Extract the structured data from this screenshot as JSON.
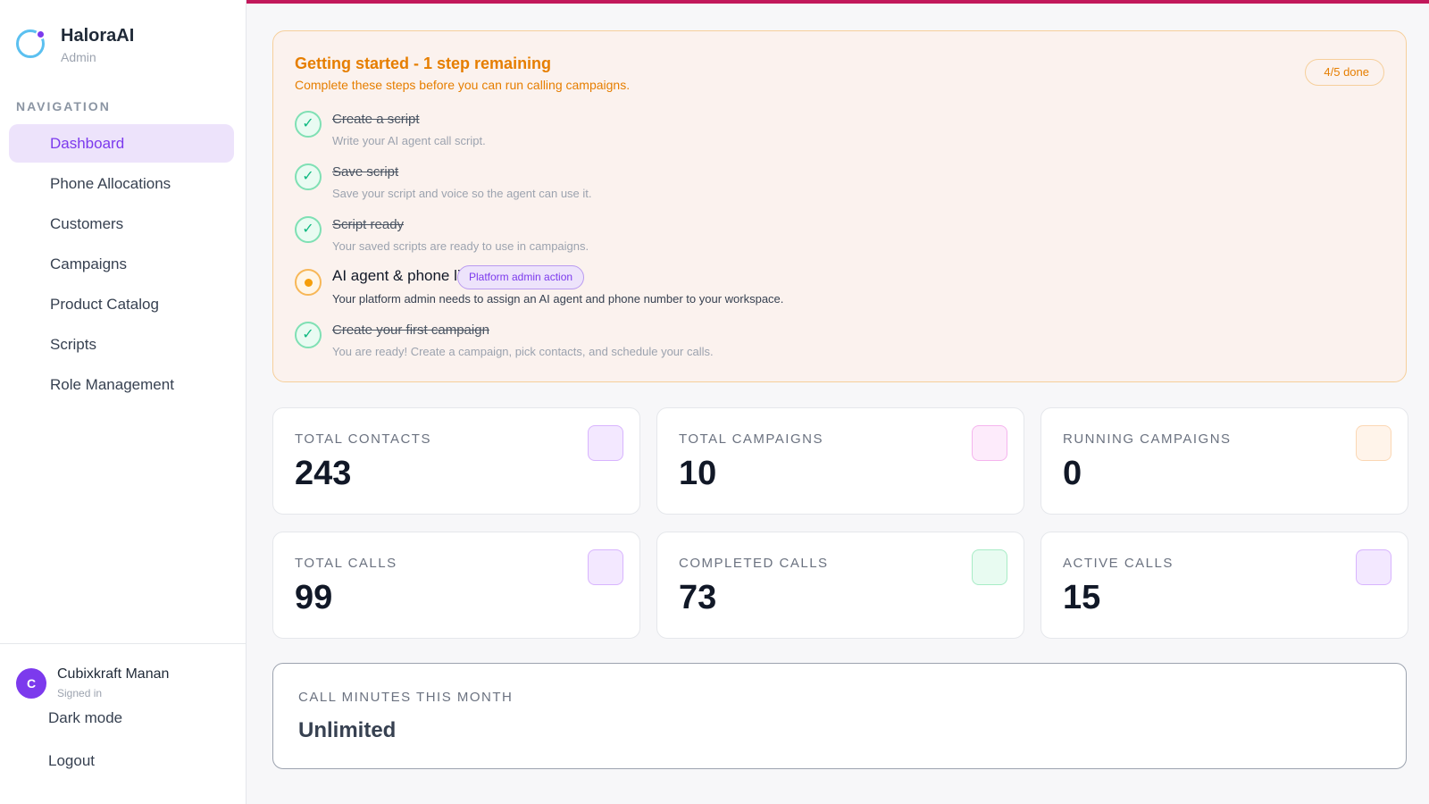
{
  "brand": {
    "name": "HaloraAI",
    "role": "Admin"
  },
  "nav": {
    "heading": "NAVIGATION",
    "items": [
      {
        "label": "Dashboard",
        "active": true
      },
      {
        "label": "Phone Allocations"
      },
      {
        "label": "Customers"
      },
      {
        "label": "Campaigns"
      },
      {
        "label": "Product Catalog"
      },
      {
        "label": "Scripts"
      },
      {
        "label": "Role Management"
      }
    ]
  },
  "user": {
    "initial": "C",
    "name": "Cubixkraft Manan",
    "status": "Signed in"
  },
  "footer": {
    "dark_mode": "Dark mode",
    "logout": "Logout"
  },
  "getting_started": {
    "title": "Getting started - 1 step remaining",
    "subtitle": "Complete these steps before you can run calling campaigns.",
    "progress": "4/5 done",
    "steps": [
      {
        "title": "Create a script",
        "description": "Write your AI agent call script.",
        "done": true
      },
      {
        "title": "Save script",
        "description": "Save your script and voice so the agent can use it.",
        "done": true
      },
      {
        "title": "Script ready",
        "description": "Your saved scripts are ready to use in campaigns.",
        "done": true
      },
      {
        "title": "AI agent & phone linked",
        "badge": "Platform admin action",
        "description": "Your platform admin needs to assign an AI agent and phone number to your workspace.",
        "done": false
      },
      {
        "title": "Create your first campaign",
        "description": "You are ready! Create a campaign, pick contacts, and schedule your calls.",
        "done": true
      }
    ],
    "check_glyph": "✓"
  },
  "stats": [
    {
      "label": "TOTAL CONTACTS",
      "value": "243",
      "icon_bg": "#f3e8ff",
      "icon_border": "#d8b4fe"
    },
    {
      "label": "TOTAL CAMPAIGNS",
      "value": "10",
      "icon_bg": "#fdebfb",
      "icon_border": "#f5b4ee"
    },
    {
      "label": "RUNNING CAMPAIGNS",
      "value": "0",
      "icon_bg": "#fff4ea",
      "icon_border": "#fbd7b4"
    },
    {
      "label": "TOTAL CALLS",
      "value": "99",
      "icon_bg": "#f3e8ff",
      "icon_border": "#d8b4fe"
    },
    {
      "label": "COMPLETED CALLS",
      "value": "73",
      "icon_bg": "#e8fbf1",
      "icon_border": "#a7ecc6"
    },
    {
      "label": "ACTIVE CALLS",
      "value": "15",
      "icon_bg": "#f3e8ff",
      "icon_border": "#d8b4fe"
    }
  ],
  "minutes": {
    "label": "CALL MINUTES THIS MONTH",
    "value": "Unlimited"
  }
}
